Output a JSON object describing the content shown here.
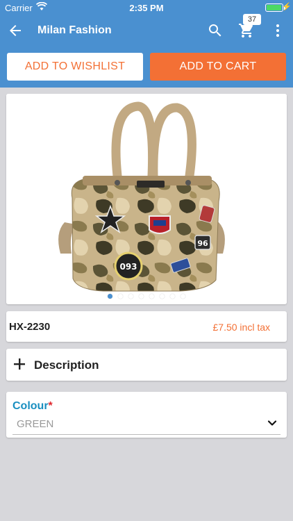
{
  "status_bar": {
    "carrier": "Carrier",
    "time": "2:35 PM"
  },
  "app_bar": {
    "title": "Milan Fashion",
    "cart_count": "37"
  },
  "actions": {
    "wishlist_label": "ADD TO WISHLIST",
    "cart_label": "ADD TO CART"
  },
  "gallery": {
    "image_count": 8,
    "active_index": 0
  },
  "product": {
    "sku": "HX-2230",
    "price": "£7.50 incl tax"
  },
  "description": {
    "label": "Description"
  },
  "colour": {
    "label": "Colour",
    "required_mark": "*",
    "value": "GREEN"
  },
  "colors": {
    "brand": "#4a90d0",
    "accent": "#f37035",
    "field_label": "#1a8fc0"
  },
  "icons": [
    "wifi-icon",
    "battery-icon",
    "back-arrow-icon",
    "search-icon",
    "cart-icon",
    "more-vert-icon",
    "plus-icon",
    "chevron-down-icon"
  ]
}
